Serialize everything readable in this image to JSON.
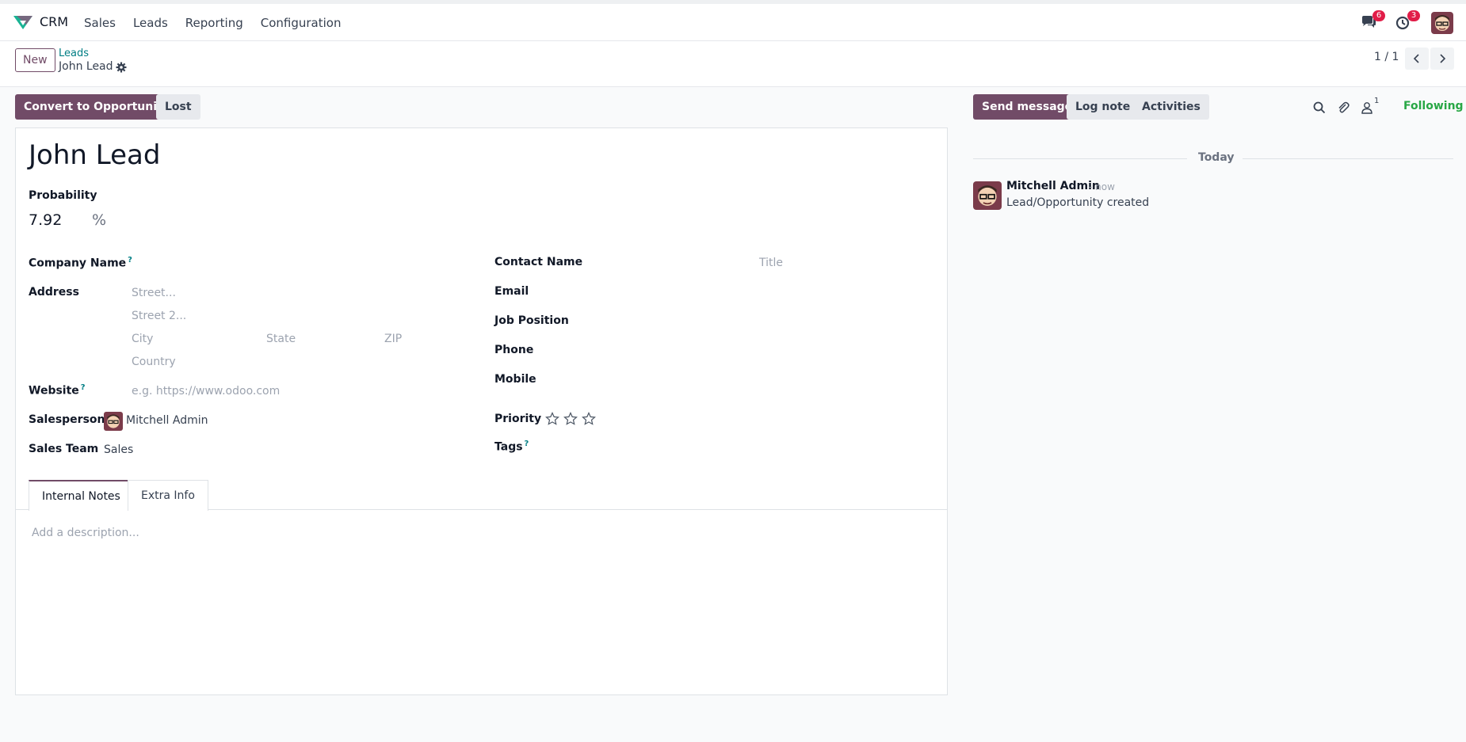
{
  "navbar": {
    "app_name": "CRM",
    "menu": [
      "Sales",
      "Leads",
      "Reporting",
      "Configuration"
    ],
    "messages_badge": "6",
    "activities_badge": "3"
  },
  "control_panel": {
    "new_label": "New",
    "breadcrumb_parent": "Leads",
    "breadcrumb_current": "John Lead",
    "pager_value": "1 / 1"
  },
  "statusbar": {
    "convert_label": "Convert to Opportunity",
    "lost_label": "Lost"
  },
  "form": {
    "title": "John Lead",
    "probability_label": "Probability",
    "probability_value": "7.92",
    "probability_unit": "%",
    "company_name_label": "Company Name",
    "address_label": "Address",
    "street_placeholder": "Street...",
    "street2_placeholder": "Street 2...",
    "city_placeholder": "City",
    "state_placeholder": "State",
    "zip_placeholder": "ZIP",
    "country_placeholder": "Country",
    "website_label": "Website",
    "website_placeholder": "e.g. https://www.odoo.com",
    "salesperson_label": "Salesperson",
    "salesperson_value": "Mitchell Admin",
    "sales_team_label": "Sales Team",
    "sales_team_value": "Sales",
    "contact_name_label": "Contact Name",
    "title_placeholder": "Title",
    "email_label": "Email",
    "job_position_label": "Job Position",
    "phone_label": "Phone",
    "mobile_label": "Mobile",
    "priority_label": "Priority",
    "priority_stars": 0,
    "tags_label": "Tags",
    "help_marker": "?"
  },
  "tabs": [
    {
      "label": "Internal Notes",
      "active": true
    },
    {
      "label": "Extra Info",
      "active": false
    }
  ],
  "notes_placeholder": "Add a description...",
  "chatter": {
    "send_message_label": "Send message",
    "log_note_label": "Log note",
    "activities_label": "Activities",
    "followers_count": "1",
    "following_label": "Following",
    "date_separator": "Today",
    "messages": [
      {
        "author": "Mitchell Admin",
        "time": "- now",
        "body": "Lead/Opportunity created"
      }
    ]
  },
  "colors": {
    "brand": "#714b67",
    "link": "#017e84",
    "following": "#28a745",
    "badge": "#e11d48"
  }
}
